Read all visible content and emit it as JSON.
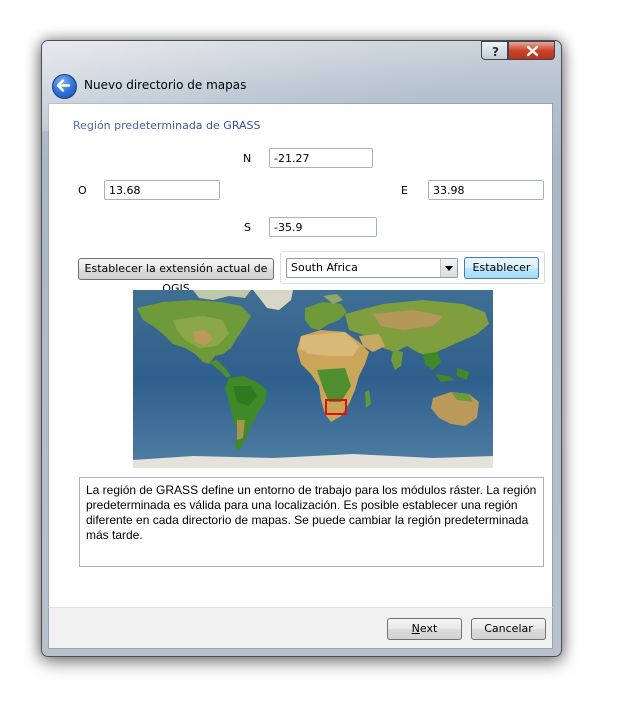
{
  "window": {
    "title": "Nuevo directorio de mapas",
    "controls": {
      "help_icon": "question-icon",
      "close_icon": "close-icon"
    }
  },
  "section": {
    "title": "Región predeterminada de GRASS"
  },
  "bounds": {
    "north": {
      "label": "N",
      "value": "-21.27"
    },
    "west": {
      "label": "O",
      "value": "13.68"
    },
    "east": {
      "label": "E",
      "value": "33.98"
    },
    "south": {
      "label": "S",
      "value": "-35.9"
    }
  },
  "actions": {
    "set_qgis_extent_label": "Establecer la extensión actual de QGIS",
    "region_select_value": "South Africa",
    "set_label": "Establecer"
  },
  "map": {
    "highlight_color": "#e01010"
  },
  "description": "La región de GRASS define un entorno de trabajo para los módulos ráster. La región predeterminada es válida para una localización. Es posible establecer una región diferente en cada directorio de mapas. Se puede cambiar la región predeterminada más tarde.",
  "footer": {
    "next_prefix": "N",
    "next_rest": "ext",
    "cancel_label": "Cancelar"
  },
  "colors": {
    "title_blue": "#1f3f8f",
    "close_red": "#c8452b"
  }
}
